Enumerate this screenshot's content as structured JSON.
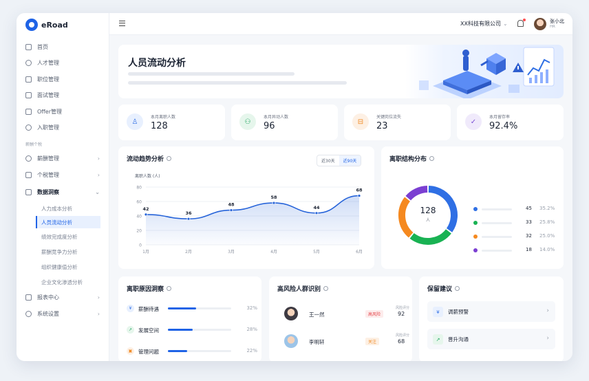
{
  "app": {
    "name": "eRoad"
  },
  "sidebar": {
    "items": [
      {
        "label": "首页"
      },
      {
        "label": "人才管理"
      },
      {
        "label": "职位管理"
      },
      {
        "label": "面试管理"
      },
      {
        "label": "Offer管理"
      },
      {
        "label": "入职管理"
      }
    ],
    "group_label": "薪酬个税",
    "groups": [
      {
        "label": "薪酬管理",
        "chevron": "›"
      },
      {
        "label": "个税管理",
        "chevron": "›"
      },
      {
        "label": "数据洞察",
        "chevron": "⌄"
      }
    ],
    "sub_items": [
      {
        "label": "人力成本分析"
      },
      {
        "label": "人员流动分析"
      },
      {
        "label": "绩效完成度分析"
      },
      {
        "label": "薪酬竞争力分析"
      },
      {
        "label": "组织健康值分析"
      },
      {
        "label": "企业文化渗透分析"
      }
    ],
    "bottom": [
      {
        "label": "报表中心",
        "chevron": "›"
      },
      {
        "label": "系统设置",
        "chevron": "›"
      }
    ]
  },
  "topbar": {
    "company": "XX科技有限公司",
    "caret": "⌄",
    "user_name": "张小北",
    "user_role": "HR"
  },
  "hero": {
    "title": "人员流动分析"
  },
  "stats": [
    {
      "label": "本月离职人数",
      "value": "128",
      "icon": "user-icon",
      "color": "#2f6fe4",
      "bg": "#e8f0fe",
      "glyph": "♙"
    },
    {
      "label": "本月异动人数",
      "value": "96",
      "icon": "group-icon",
      "color": "#19a35b",
      "bg": "#e6f6ec",
      "glyph": "⚇"
    },
    {
      "label": "关键岗位流失",
      "value": "23",
      "icon": "lock-icon",
      "color": "#f08a24",
      "bg": "#fdf0e4",
      "glyph": "⊟"
    },
    {
      "label": "本月留存率",
      "value": "92.4%",
      "icon": "shield-icon",
      "color": "#7b4fd6",
      "bg": "#f0eafb",
      "glyph": "✓"
    }
  ],
  "trend": {
    "title": "流动趋势分析",
    "segments": [
      "近30天",
      "近90天"
    ],
    "active_segment": 1
  },
  "chart_data": {
    "type": "area",
    "ylabel": "离职人数 (人)",
    "categories": [
      "1月",
      "2月",
      "3月",
      "4月",
      "5月",
      "6月"
    ],
    "values": [
      42,
      36,
      48,
      58,
      44,
      68
    ],
    "ylim": [
      0,
      80
    ],
    "yticks": [
      0,
      20,
      40,
      60,
      80
    ],
    "data_labels": [
      "42",
      "36",
      "48",
      "58",
      "44",
      "68"
    ],
    "color": "#2563d9"
  },
  "structure": {
    "title": "离职结构分布",
    "total": "128",
    "unit": "人",
    "legend": [
      {
        "count": "45",
        "pct": "35.2%",
        "value": 45,
        "color": "#2f6fe4"
      },
      {
        "count": "33",
        "pct": "25.8%",
        "value": 33,
        "color": "#19b253"
      },
      {
        "count": "32",
        "pct": "25.0%",
        "value": 32,
        "color": "#f5891f"
      },
      {
        "count": "18",
        "pct": "14.0%",
        "value": 18,
        "color": "#7b3fd2"
      }
    ]
  },
  "reasons": {
    "title": "离职原因洞察",
    "items": [
      {
        "label": "薪酬待遇",
        "pct": "32%",
        "value": 0.32,
        "icon": "yen-icon",
        "glyph": "¥",
        "color": "#2f6fe4",
        "bg": "#e8f0fe"
      },
      {
        "label": "发展空间",
        "pct": "28%",
        "value": 0.28,
        "icon": "trend-up-icon",
        "glyph": "↗",
        "color": "#19a35b",
        "bg": "#e6f6ec"
      },
      {
        "label": "管理问题",
        "pct": "22%",
        "value": 0.22,
        "icon": "briefcase-icon",
        "glyph": "▣",
        "color": "#f08a24",
        "bg": "#fdf0e4"
      }
    ]
  },
  "risk": {
    "title": "高风险人群识别",
    "people": [
      {
        "name": "王一然",
        "tag": "高风险",
        "tag_color": "#e5484d",
        "tag_bg": "#fdecec",
        "score_label": "风险评分",
        "score": "92"
      },
      {
        "name": "李明轩",
        "tag": "关注",
        "tag_color": "#f08a24",
        "tag_bg": "#fdf0e4",
        "score_label": "风险评分",
        "score": "68"
      }
    ]
  },
  "advice": {
    "title": "保留建议",
    "items": [
      {
        "label": "调薪预警",
        "icon": "yen-icon",
        "glyph": "¥",
        "color": "#2f6fe4",
        "bg": "#e8f0fe",
        "chevron": "›"
      },
      {
        "label": "晋升沟通",
        "icon": "trend-up-icon",
        "glyph": "↗",
        "color": "#19a35b",
        "bg": "#e6f6ec",
        "chevron": "›"
      }
    ]
  }
}
